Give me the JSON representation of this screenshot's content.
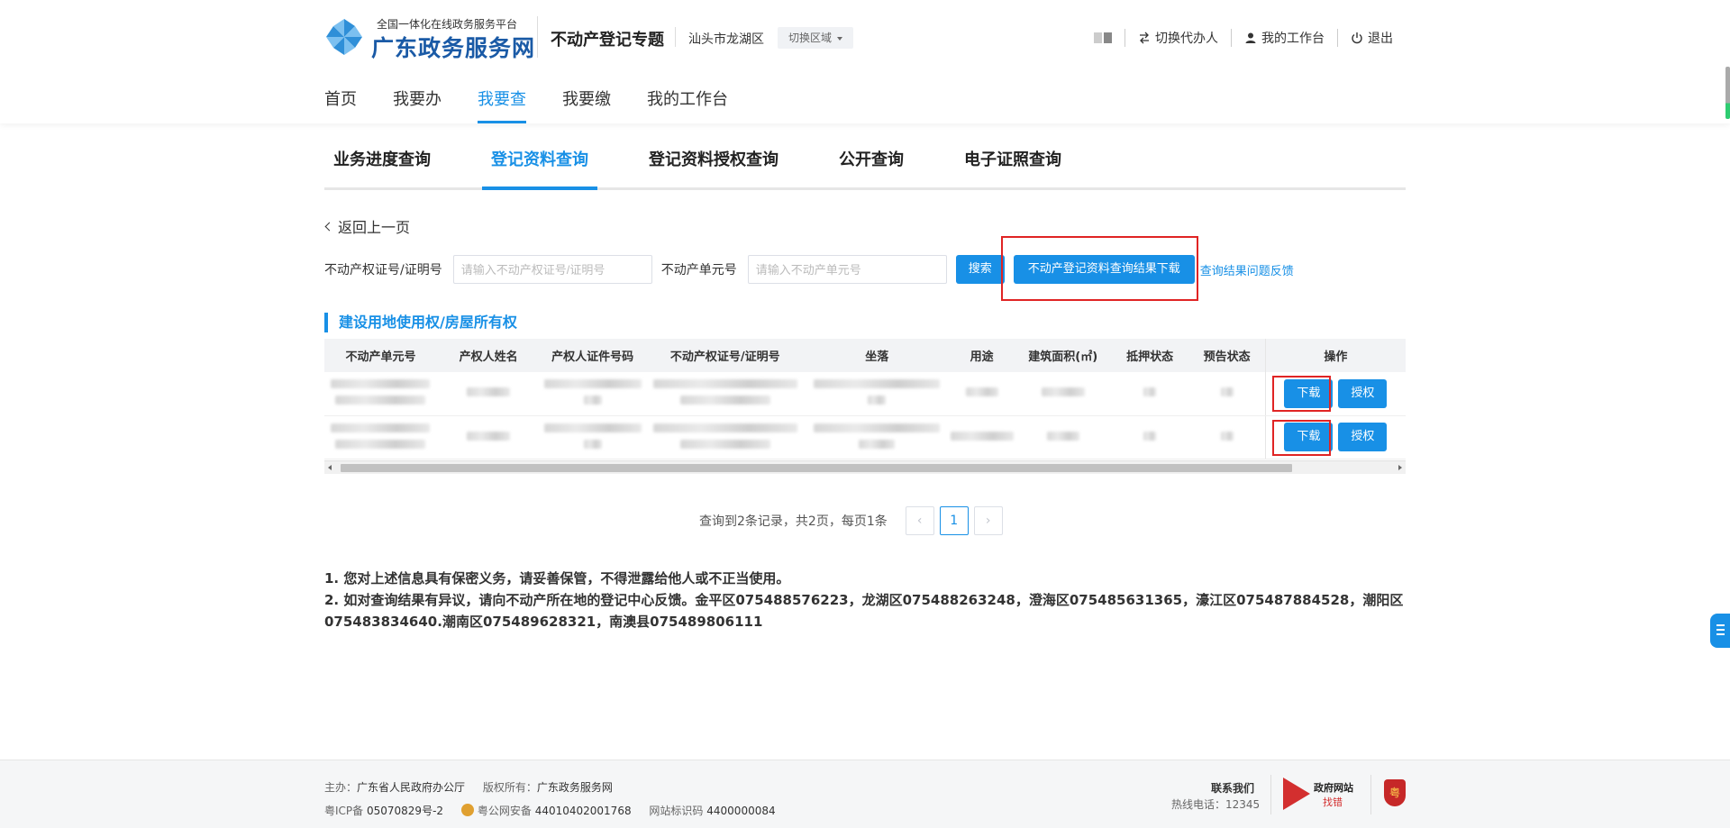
{
  "brand": {
    "subtitle": "全国一体化在线政务服务平台",
    "name": "广东政务服务网",
    "topic": "不动产登记专题",
    "region": "汕头市龙湖区",
    "switch_region": "切换区域",
    "logo_color": "#2f8fd8"
  },
  "top_right": {
    "proxy": "切换代办人",
    "workbench": "我的工作台",
    "logout": "退出"
  },
  "main_nav": [
    "首页",
    "我要办",
    "我要查",
    "我要缴",
    "我的工作台"
  ],
  "sub_tabs": [
    "业务进度查询",
    "登记资料查询",
    "登记资料授权查询",
    "公开查询",
    "电子证照查询"
  ],
  "back_label": "返回上一页",
  "search": {
    "cert_label": "不动产权证号/证明号",
    "cert_placeholder": "请输入不动产权证号/证明号",
    "unit_label": "不动产单元号",
    "unit_placeholder": "请输入不动产单元号",
    "search_button": "搜索",
    "download_button": "不动产登记资料查询结果下载",
    "feedback_link": "查询结果问题反馈"
  },
  "section_title": "建设用地使用权/房屋所有权",
  "table": {
    "headers": [
      "不动产单元号",
      "产权人姓名",
      "产权人证件号码",
      "不动产权证号/证明号",
      "坐落",
      "用途",
      "建筑面积(㎡)",
      "抵押状态",
      "预告状态",
      "操作"
    ],
    "rows": [
      {
        "download": "下载",
        "authorize": "授权"
      },
      {
        "download": "下载",
        "authorize": "授权"
      }
    ]
  },
  "pagination": {
    "summary": "查询到2条记录，共2页，每页1条",
    "current_page": "1"
  },
  "notes": [
    "1. 您对上述信息具有保密义务，请妥善保管，不得泄露给他人或不正当使用。",
    "2. 如对查询结果有异议，请向不动产所在地的登记中心反馈。金平区075488576223，龙湖区075488263248，澄海区075485631365，濠江区075487884528，潮阳区075483834640.潮南区075489628321，南澳县075489806111"
  ],
  "footer": {
    "host_label": "主办：",
    "host": "广东省人民政府办公厅",
    "copyright_label": "版权所有：",
    "copyright": "广东政务服务网",
    "icp_label": "粤ICP备",
    "icp": "05070829号-2",
    "police_label": "粤公网安备",
    "police": "44010402001768",
    "site_id_label": "网站标识码",
    "site_id": "4400000084",
    "contact_title": "联系我们",
    "hotline": "热线电话：12345",
    "gov_badge_title": "政府网站",
    "gov_badge_sub": "找错",
    "emblem_char": "粤"
  }
}
